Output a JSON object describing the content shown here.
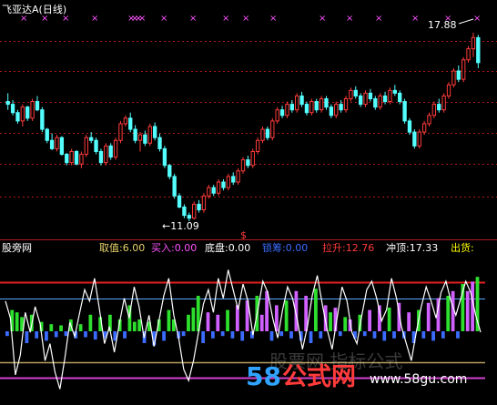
{
  "top_panel": {
    "title": "飞亚达A(日线)",
    "title_color": "#ffffff",
    "high_label": "17.88",
    "low_label": "←11.09",
    "dollar_marker": "$"
  },
  "bottom_panel": {
    "title": "股旁网",
    "indicators": [
      {
        "key": "quzhi",
        "label": "取值:",
        "value": "6.00",
        "label_color": "#e6d36a",
        "value_color": "#e6d36a"
      },
      {
        "key": "mairu",
        "label": "买入:",
        "value": "0.00",
        "label_color": "#ff55ff",
        "value_color": "#ff55ff"
      },
      {
        "key": "dipan",
        "label": "底盘:",
        "value": "0.00",
        "label_color": "#ffffff",
        "value_color": "#ffffff"
      },
      {
        "key": "shouchou",
        "label": "锁筹:",
        "value": "0.00",
        "label_color": "#3b6cff",
        "value_color": "#3b6cff"
      },
      {
        "key": "lasheng",
        "label": "拉升:",
        "value": "12.76",
        "label_color": "#ff3b3b",
        "value_color": "#ff3b3b"
      },
      {
        "key": "chongding",
        "label": "冲顶:",
        "value": "17.33",
        "label_color": "#ffffff",
        "value_color": "#ffffff"
      },
      {
        "key": "chuhuo",
        "label": "出货:",
        "value": "",
        "label_color": "#ffff00",
        "value_color": "#ffff00"
      }
    ]
  },
  "watermark": {
    "number": "58",
    "text": "公式网",
    "url": "www.58gu.com",
    "faint_text": "股票网 指标公式"
  },
  "colors": {
    "up_candle": "#ff3b3b",
    "down_candle": "#54ffff",
    "grid": "#b01818",
    "cross_marker": "#ff55ff",
    "white_line": "#ffffff",
    "bar_green": "#2ee02e",
    "bar_magenta": "#d060ff",
    "hline_red": "#e02020",
    "hline_blue": "#5aa6ff",
    "hline_gold": "#b8a060",
    "hline_magenta": "#d040d0"
  },
  "chart_data": [
    {
      "type": "candlestick",
      "title": "飞亚达A(日线)",
      "annotations": [
        {
          "text": "17.88",
          "series_point": "max_high"
        },
        {
          "text": "←11.09",
          "series_point": "min_low"
        }
      ],
      "ylim": [
        10.6,
        18.4
      ],
      "series": [
        {
          "name": "",
          "ohlc": [
            [
              15.4,
              15.7,
              15.1,
              15.3
            ],
            [
              15.3,
              15.45,
              14.9,
              15.0
            ],
            [
              15.0,
              15.1,
              14.6,
              14.7
            ],
            [
              14.7,
              15.3,
              14.5,
              15.2
            ],
            [
              15.2,
              15.25,
              14.7,
              14.8
            ],
            [
              14.8,
              15.5,
              14.7,
              15.4
            ],
            [
              15.4,
              15.6,
              15.05,
              15.1
            ],
            [
              15.1,
              15.2,
              14.3,
              14.4
            ],
            [
              14.4,
              14.45,
              13.9,
              14.0
            ],
            [
              14.0,
              14.25,
              13.65,
              13.7
            ],
            [
              13.7,
              14.2,
              13.6,
              14.1
            ],
            [
              14.1,
              14.15,
              13.45,
              13.5
            ],
            [
              13.5,
              13.55,
              13.1,
              13.2
            ],
            [
              13.2,
              13.7,
              13.1,
              13.6
            ],
            [
              13.6,
              13.65,
              13.1,
              13.15
            ],
            [
              13.15,
              13.6,
              13.0,
              13.5
            ],
            [
              13.5,
              14.2,
              13.4,
              14.1
            ],
            [
              14.1,
              14.3,
              13.9,
              14.0
            ],
            [
              14.0,
              14.1,
              13.5,
              13.6
            ],
            [
              13.6,
              13.7,
              13.1,
              13.2
            ],
            [
              13.2,
              13.9,
              13.1,
              13.8
            ],
            [
              13.8,
              13.9,
              13.3,
              13.4
            ],
            [
              13.4,
              14.1,
              13.3,
              14.0
            ],
            [
              14.0,
              14.7,
              13.9,
              14.6
            ],
            [
              14.6,
              14.9,
              14.5,
              14.8
            ],
            [
              14.8,
              15.0,
              14.3,
              14.4
            ],
            [
              14.4,
              14.55,
              13.9,
              14.0
            ],
            [
              14.0,
              14.3,
              13.6,
              14.2
            ],
            [
              14.2,
              14.35,
              13.8,
              13.9
            ],
            [
              13.9,
              14.6,
              13.8,
              14.5
            ],
            [
              14.5,
              14.65,
              14.0,
              14.1
            ],
            [
              14.1,
              14.25,
              13.6,
              13.7
            ],
            [
              13.7,
              13.8,
              13.0,
              13.1
            ],
            [
              13.1,
              13.15,
              12.6,
              12.7
            ],
            [
              12.7,
              12.8,
              11.9,
              12.0
            ],
            [
              12.0,
              12.1,
              11.55,
              11.6
            ],
            [
              11.6,
              11.7,
              11.2,
              11.3
            ],
            [
              11.3,
              11.4,
              11.09,
              11.2
            ],
            [
              11.2,
              11.8,
              11.15,
              11.7
            ],
            [
              11.7,
              11.85,
              11.4,
              11.5
            ],
            [
              11.5,
              12.1,
              11.4,
              12.0
            ],
            [
              12.0,
              12.4,
              11.9,
              12.3
            ],
            [
              12.3,
              12.4,
              12.0,
              12.1
            ],
            [
              12.1,
              12.6,
              12.0,
              12.5
            ],
            [
              12.5,
              12.6,
              12.2,
              12.3
            ],
            [
              12.3,
              12.8,
              12.2,
              12.7
            ],
            [
              12.7,
              12.85,
              12.4,
              12.5
            ],
            [
              12.5,
              13.0,
              12.4,
              12.9
            ],
            [
              12.9,
              13.4,
              12.8,
              13.3
            ],
            [
              13.3,
              13.45,
              13.0,
              13.1
            ],
            [
              13.1,
              13.7,
              13.0,
              13.6
            ],
            [
              13.6,
              14.1,
              13.5,
              14.0
            ],
            [
              14.0,
              14.5,
              13.9,
              14.4
            ],
            [
              14.4,
              14.5,
              14.0,
              14.1
            ],
            [
              14.1,
              14.8,
              14.0,
              14.7
            ],
            [
              14.7,
              15.2,
              14.6,
              15.1
            ],
            [
              15.1,
              15.25,
              14.8,
              14.9
            ],
            [
              14.9,
              15.4,
              14.8,
              15.3
            ],
            [
              15.3,
              15.45,
              15.0,
              15.1
            ],
            [
              15.1,
              15.7,
              15.0,
              15.6
            ],
            [
              15.6,
              15.75,
              15.2,
              15.3
            ],
            [
              15.3,
              15.4,
              14.9,
              15.0
            ],
            [
              15.0,
              15.5,
              14.9,
              15.4
            ],
            [
              15.4,
              15.5,
              15.0,
              15.1
            ],
            [
              15.1,
              15.6,
              15.0,
              15.5
            ],
            [
              15.5,
              15.6,
              15.1,
              15.2
            ],
            [
              15.2,
              15.3,
              14.8,
              14.9
            ],
            [
              14.9,
              15.4,
              14.8,
              15.3
            ],
            [
              15.3,
              15.45,
              15.0,
              15.1
            ],
            [
              15.1,
              15.6,
              15.0,
              15.5
            ],
            [
              15.5,
              15.9,
              15.4,
              15.8
            ],
            [
              15.8,
              15.95,
              15.5,
              15.6
            ],
            [
              15.6,
              15.7,
              15.2,
              15.3
            ],
            [
              15.3,
              15.8,
              15.2,
              15.7
            ],
            [
              15.7,
              15.85,
              15.4,
              15.5
            ],
            [
              15.5,
              15.6,
              15.1,
              15.2
            ],
            [
              15.2,
              15.7,
              15.1,
              15.6
            ],
            [
              15.6,
              15.75,
              15.3,
              15.4
            ],
            [
              15.4,
              15.9,
              15.3,
              15.8
            ],
            [
              15.8,
              16.0,
              15.6,
              15.7
            ],
            [
              15.7,
              15.8,
              15.3,
              15.4
            ],
            [
              15.4,
              15.5,
              14.6,
              14.7
            ],
            [
              14.7,
              14.8,
              14.2,
              14.3
            ],
            [
              14.3,
              14.4,
              13.7,
              13.8
            ],
            [
              13.8,
              14.4,
              13.7,
              14.3
            ],
            [
              14.3,
              14.7,
              14.2,
              14.6
            ],
            [
              14.6,
              15.0,
              14.5,
              14.9
            ],
            [
              14.9,
              15.4,
              14.8,
              15.3
            ],
            [
              15.3,
              15.5,
              15.0,
              15.1
            ],
            [
              15.1,
              15.7,
              15.0,
              15.6
            ],
            [
              15.6,
              16.1,
              15.5,
              16.0
            ],
            [
              16.0,
              16.6,
              15.9,
              16.5
            ],
            [
              16.5,
              16.7,
              16.1,
              16.2
            ],
            [
              16.2,
              17.0,
              16.1,
              16.9
            ],
            [
              16.9,
              17.4,
              16.8,
              17.3
            ],
            [
              17.3,
              17.88,
              17.0,
              17.7
            ],
            [
              17.7,
              17.8,
              16.6,
              16.8
            ]
          ]
        }
      ]
    },
    {
      "type": "line",
      "title": "股旁网",
      "ylim": [
        0,
        100
      ],
      "series": [
        {
          "name": "",
          "values": [
            70,
            58,
            18,
            32,
            62,
            48,
            66,
            54,
            28,
            40,
            20,
            8,
            30,
            55,
            45,
            62,
            78,
            70,
            86,
            64,
            40,
            52,
            34,
            54,
            72,
            58,
            80,
            66,
            44,
            60,
            38,
            56,
            74,
            86,
            60,
            44,
            22,
            14,
            28,
            48,
            68,
            78,
            62,
            86,
            72,
            92,
            78,
            64,
            82,
            70,
            46,
            64,
            84,
            76,
            58,
            44,
            64,
            80,
            72,
            56,
            36,
            52,
            74,
            88,
            68,
            50,
            36,
            58,
            80,
            70,
            48,
            40,
            60,
            78,
            84,
            72,
            56,
            64,
            86,
            72,
            52,
            40,
            28,
            48,
            66,
            80,
            70,
            58,
            76,
            84,
            70,
            60,
            72,
            84,
            76,
            60,
            48
          ]
        }
      ]
    },
    {
      "type": "bar",
      "title": "",
      "ylim": [
        -20,
        100
      ],
      "series": [
        {
          "name": "",
          "values": [
            -4,
            18,
            16,
            12,
            -10,
            14,
            -6,
            8,
            -8,
            6,
            -5,
            5,
            -4,
            10,
            -6,
            6,
            -5,
            14,
            -7,
            12,
            -6,
            14,
            -8,
            10,
            -6,
            22,
            8,
            10,
            -10,
            8,
            -12,
            10,
            -8,
            18,
            10,
            -6,
            -4,
            14,
            20,
            30,
            -10,
            16,
            -6,
            14,
            -4,
            18,
            -6,
            22,
            -8,
            26,
            -6,
            30,
            14,
            34,
            -8,
            22,
            -4,
            26,
            -6,
            34,
            -8,
            30,
            -10,
            36,
            -6,
            22,
            16,
            20,
            -4,
            12,
            10,
            -6,
            14,
            -4,
            18,
            -6,
            22,
            -8,
            20,
            -6,
            24,
            -6,
            16,
            -10,
            18,
            -6,
            24,
            -8,
            28,
            -6,
            30,
            34,
            -6,
            40,
            34,
            42,
            46
          ]
        }
      ]
    }
  ]
}
